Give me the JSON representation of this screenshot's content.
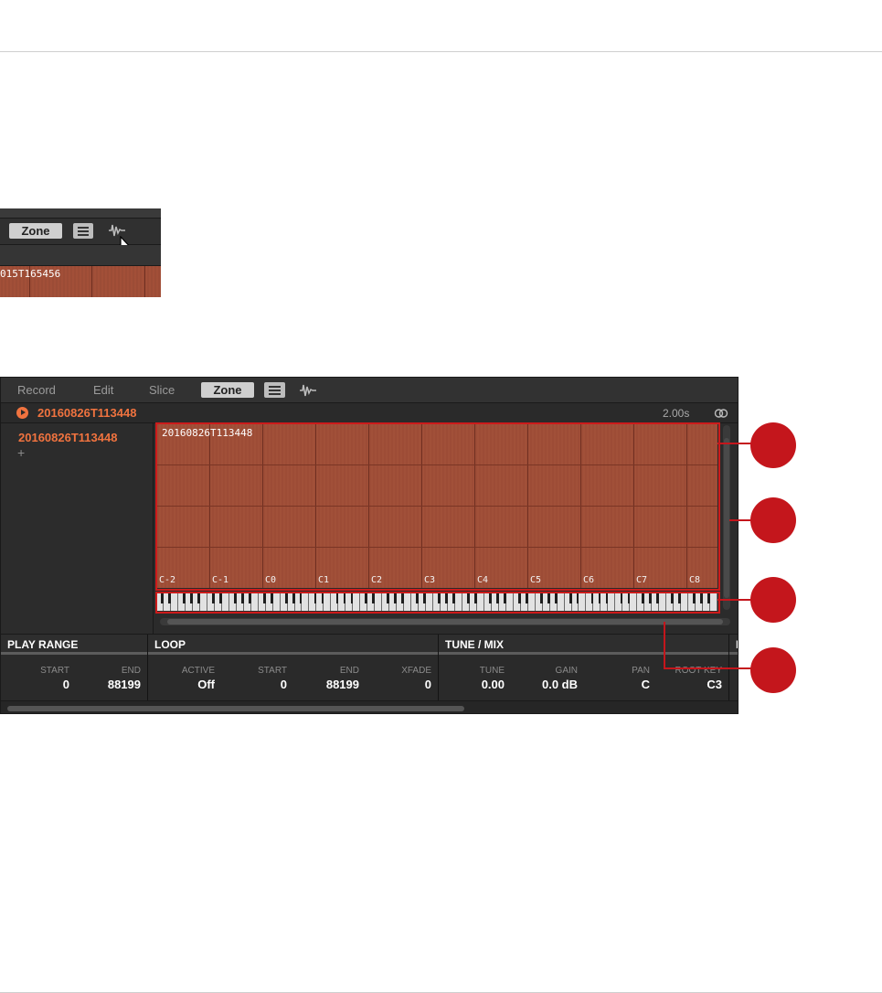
{
  "inset": {
    "zone_tab": "Zone",
    "sample_label": "015T165456"
  },
  "tabs": {
    "record": "Record",
    "edit": "Edit",
    "slice": "Slice",
    "zone": "Zone"
  },
  "sample": {
    "name": "20160826T113448",
    "duration": "2.00s"
  },
  "zone_list": {
    "item": "20160826T113448",
    "add_label": "+"
  },
  "zone_map": {
    "label": "20160826T113448",
    "notes": [
      "C-2",
      "C-1",
      "C0",
      "C1",
      "C2",
      "C3",
      "C4",
      "C5",
      "C6",
      "C7",
      "C8"
    ]
  },
  "params": {
    "play_range": {
      "title": "PLAY RANGE",
      "start_label": "START",
      "start": "0",
      "end_label": "END",
      "end": "88199"
    },
    "loop": {
      "title": "LOOP",
      "active_label": "ACTIVE",
      "active": "Off",
      "start_label": "START",
      "start": "0",
      "end_label": "END",
      "end": "88199",
      "xfade_label": "XFADE",
      "xfade": "0"
    },
    "tune_mix": {
      "title": "TUNE / MIX",
      "tune_label": "TUNE",
      "tune": "0.00",
      "gain_label": "GAIN",
      "gain": "0.0 dB",
      "pan_label": "PAN",
      "pan": "C",
      "root_key_label": "ROOT KEY",
      "root_key": "C3"
    },
    "next_section_initial": "I"
  },
  "colors": {
    "accent": "#f0733f",
    "highlight": "#cc1b1b",
    "callout": "#c4161c",
    "sample_fill": "#a3513a",
    "panel_bg": "#2b2b2b"
  },
  "icons": [
    "hamburger-menu-icon",
    "waveform-icon",
    "mouse-cursor-icon",
    "play-icon",
    "stereo-link-icon"
  ]
}
